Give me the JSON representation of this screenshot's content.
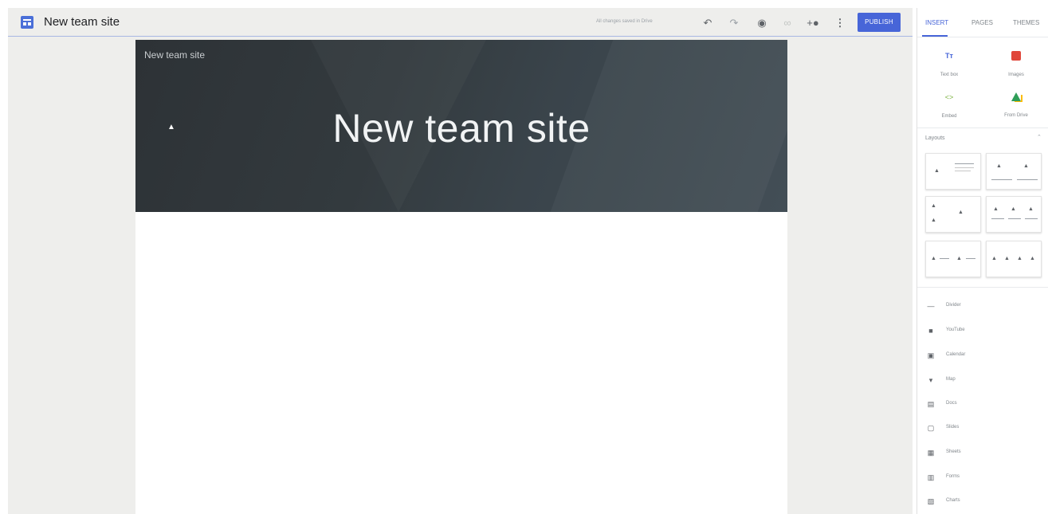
{
  "header": {
    "site_title": "New team site",
    "saved_status": "All changes saved in Drive",
    "publish_label": "PUBLISH"
  },
  "page": {
    "nav_site_name": "New team site",
    "hero_title": "New team site"
  },
  "panel": {
    "tabs": [
      {
        "label": "INSERT",
        "active": true
      },
      {
        "label": "PAGES",
        "active": false
      },
      {
        "label": "THEMES",
        "active": false
      }
    ],
    "insert_items": [
      {
        "label": "Text box",
        "icon": "text-box-icon"
      },
      {
        "label": "Images",
        "icon": "image-icon"
      },
      {
        "label": "Embed",
        "icon": "embed-icon"
      },
      {
        "label": "From Drive",
        "icon": "drive-icon"
      }
    ],
    "layouts_label": "Layouts",
    "embed_items": [
      {
        "label": "Divider",
        "icon": "divider-icon"
      },
      {
        "label": "YouTube",
        "icon": "youtube-icon"
      },
      {
        "label": "Calendar",
        "icon": "calendar-icon"
      },
      {
        "label": "Map",
        "icon": "map-pin-icon"
      },
      {
        "label": "Docs",
        "icon": "docs-icon"
      },
      {
        "label": "Slides",
        "icon": "slides-icon"
      },
      {
        "label": "Sheets",
        "icon": "sheets-icon"
      },
      {
        "label": "Forms",
        "icon": "forms-icon"
      },
      {
        "label": "Charts",
        "icon": "charts-icon"
      }
    ]
  },
  "colors": {
    "accent": "#4765d8",
    "canvas_bg": "#eeeeec",
    "hero_bg": "#333a3e"
  }
}
